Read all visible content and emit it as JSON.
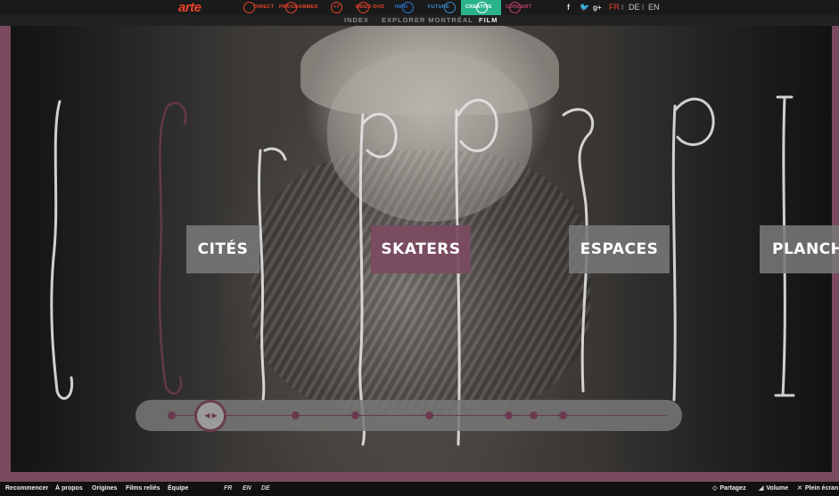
{
  "top_nav": {
    "logo": "arte",
    "items": [
      {
        "label": "DIRECT",
        "color": "#e8442a"
      },
      {
        "label": "PROGRAMMES",
        "color": "#e8442a"
      },
      {
        "label": "+7",
        "color": "#e8442a"
      },
      {
        "label": "VIDEO·DVD",
        "color": "#e8442a"
      },
      {
        "label": "INFO",
        "color": "#2a7ad8"
      },
      {
        "label": "FUTURE",
        "color": "#3a8ad0"
      },
      {
        "label": "CREATIVE",
        "color": "#ffffff",
        "bg": "#2ab38a"
      },
      {
        "label": "CONCERT",
        "color": "#c8406a"
      }
    ],
    "social": {
      "facebook": "f",
      "twitter": "🐦",
      "google": "g+"
    },
    "languages": [
      {
        "code": "FR",
        "active": true
      },
      {
        "code": "DE",
        "active": false
      },
      {
        "code": "EN",
        "active": false
      }
    ],
    "lang_separator": "I"
  },
  "sub_nav": {
    "items": [
      {
        "label": "INDEX",
        "active": false
      },
      {
        "label": "EXPLORER MONTRÉAL",
        "active": false
      },
      {
        "label": "FILM",
        "active": true
      }
    ]
  },
  "categories": [
    {
      "label": "CITÉS",
      "active": false
    },
    {
      "label": "SKATERS",
      "active": true
    },
    {
      "label": "ESPACES",
      "active": false
    },
    {
      "label": "PLANCHE",
      "active": false
    }
  ],
  "timeline": {
    "handle_glyph": "◀ ▶",
    "progress": 0.08,
    "markers": [
      0.0,
      0.25,
      0.37,
      0.52,
      0.68,
      0.73,
      0.79
    ],
    "accent": "#6a3a50"
  },
  "bottom_bar": {
    "left_items": [
      "Recommencer",
      "À propos",
      "Origines",
      "Films reliés",
      "Équipe"
    ],
    "languages": [
      "FR",
      "EN",
      "DE"
    ],
    "right_items": [
      {
        "label": "Partagez",
        "icon": "share-icon",
        "glyph": "◇"
      },
      {
        "label": "Volume",
        "icon": "volume-icon",
        "glyph": "◢"
      },
      {
        "label": "Plein écran",
        "icon": "fullscreen-icon",
        "glyph": "✕"
      }
    ]
  },
  "colors": {
    "frame": "#7a4a60",
    "active_tile": "#7b4a60",
    "arte_orange": "#e8442a"
  }
}
